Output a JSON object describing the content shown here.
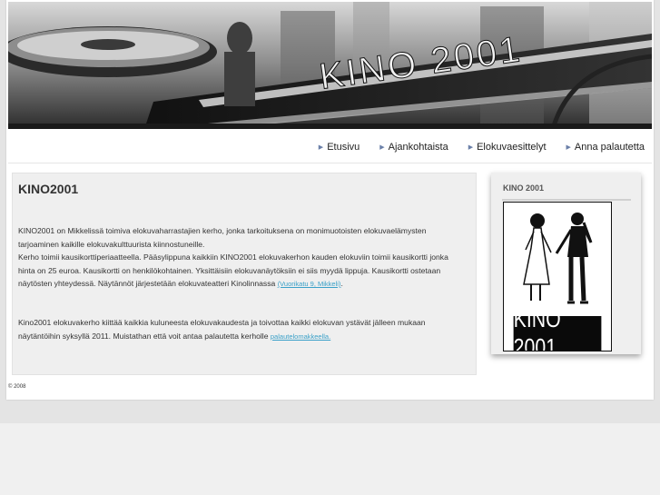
{
  "banner": {
    "text": "KINO 2001"
  },
  "nav": {
    "items": [
      {
        "label": "Etusivu"
      },
      {
        "label": "Ajankohtaista"
      },
      {
        "label": "Elokuvaesittelyt"
      },
      {
        "label": "Anna palautetta"
      }
    ]
  },
  "main": {
    "title": "KINO2001",
    "p1": "KINO2001 on Mikkelissä toimiva elokuvaharrastajien kerho, jonka tarkoituksena on monimuotoisten elokuvaelämysten tarjoaminen kaikille elokuvakulttuurista kiinnostuneille.",
    "p2": "Kerho toimii kausikorttiperiaatteella. Pääsylippuna kaikkiin KINO2001 elokuvakerhon kauden elokuviin toimii kausikortti jonka hinta on 25 euroa. Kausikortti on henkilökohtainen. Yksittäisiin elokuvanäytöksiin ei siis myydä lippuja. Kausikortti ostetaan näytösten yhteydessä. Näytännöt järjestetään elokuvateatteri Kinolinnassa",
    "p2_link": "(Vuorikatu 9, Mikkeli)",
    "p2_end": ".",
    "p3": "Kino2001 elokuvakerho kiittää kaikkia kuluneesta elokuvakaudesta ja toivottaa kaikki elokuvan ystävät jälleen mukaan näytäntöihin syksyllä 2011. Muistathan että voit antaa palautetta kerholle",
    "p3_link": "palautelomakkeella."
  },
  "sidebar": {
    "title": "KINO 2001",
    "logo_text": "KINO 2001"
  },
  "footer": {
    "copyright": "© 2008"
  }
}
